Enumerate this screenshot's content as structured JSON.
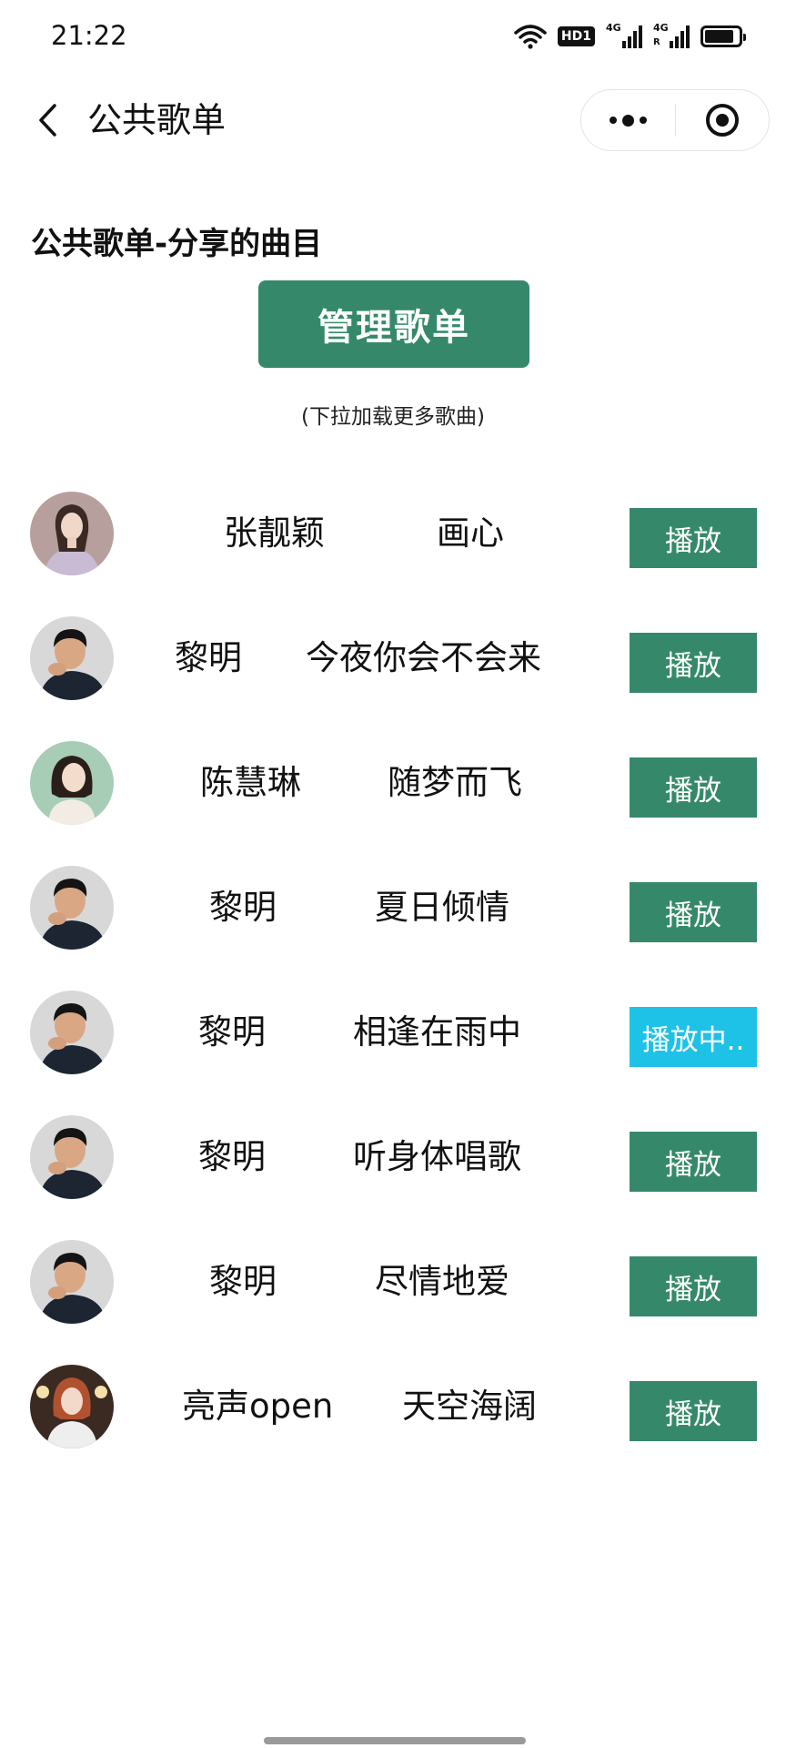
{
  "status_bar": {
    "time": "21:22",
    "hd_label": "HD1",
    "signal1_label": "4G",
    "signal2_label": "4G",
    "signal2_sub": "R"
  },
  "nav": {
    "title": "公共歌单"
  },
  "main": {
    "heading": "公共歌单-分享的曲目",
    "manage_label": "管理歌单",
    "hint": "(下拉加载更多歌曲)"
  },
  "songs": [
    {
      "artist": "张靓颖",
      "title": "画心",
      "button": "播放",
      "state": "idle",
      "avatar": "female-singer-1"
    },
    {
      "artist": "黎明",
      "title": "今夜你会不会来",
      "button": "播放",
      "state": "idle",
      "avatar": "male-singer"
    },
    {
      "artist": "陈慧琳",
      "title": "随梦而飞",
      "button": "播放",
      "state": "idle",
      "avatar": "female-singer-2"
    },
    {
      "artist": "黎明",
      "title": "夏日倾情",
      "button": "播放",
      "state": "idle",
      "avatar": "male-singer"
    },
    {
      "artist": "黎明",
      "title": "相逢在雨中",
      "button": "播放中..",
      "state": "playing",
      "avatar": "male-singer"
    },
    {
      "artist": "黎明",
      "title": "听身体唱歌",
      "button": "播放",
      "state": "idle",
      "avatar": "male-singer"
    },
    {
      "artist": "黎明",
      "title": "尽情地爱",
      "button": "播放",
      "state": "idle",
      "avatar": "male-singer"
    },
    {
      "artist": "亮声open",
      "title": "天空海阔",
      "button": "播放",
      "state": "idle",
      "avatar": "female-singer-3"
    }
  ],
  "colors": {
    "accent": "#35896a",
    "playing": "#1ec2e6"
  }
}
